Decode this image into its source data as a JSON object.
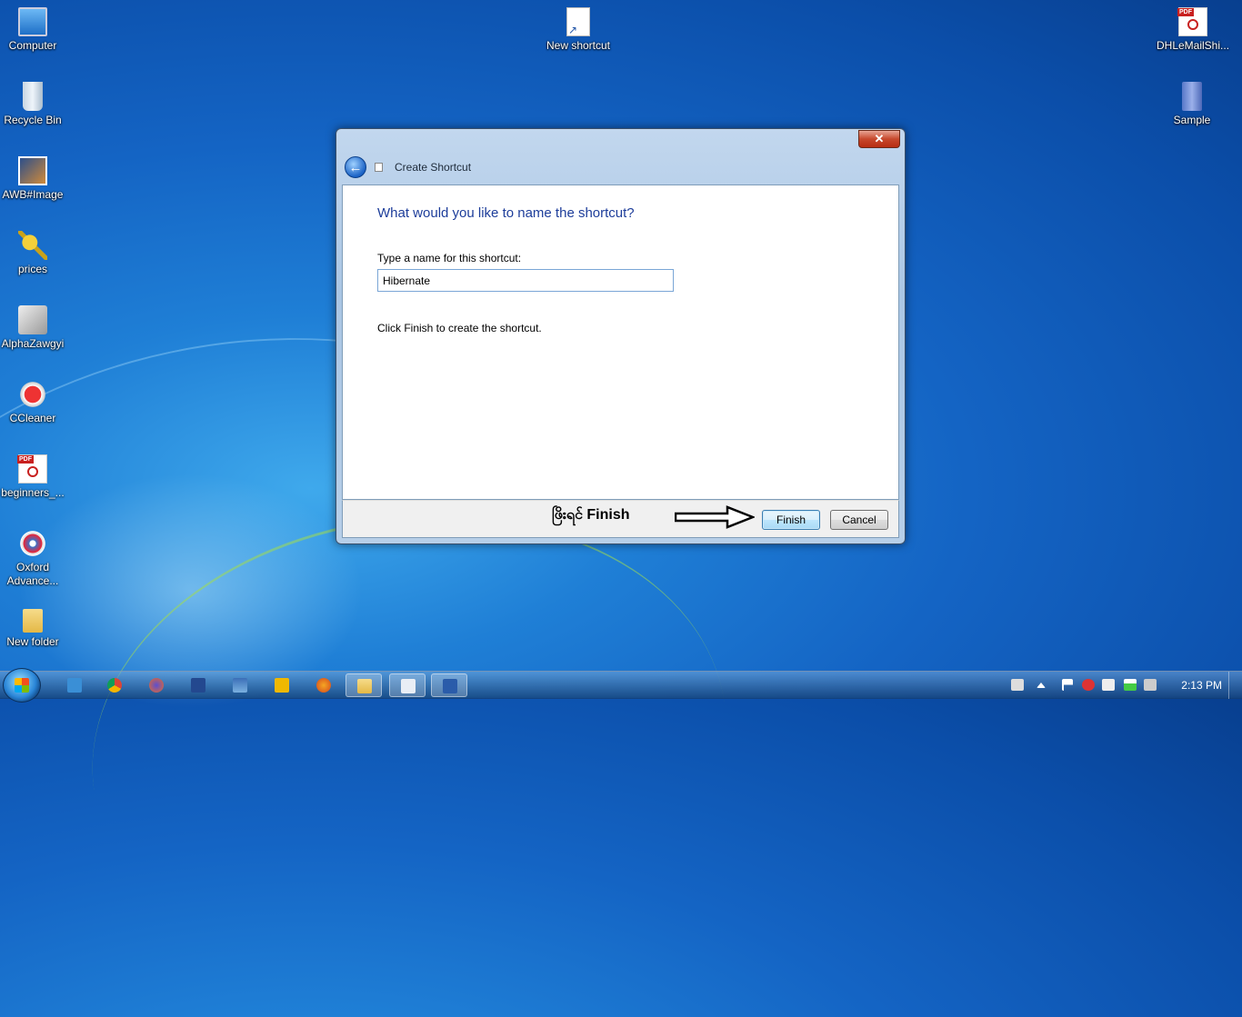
{
  "desktop": {
    "icons_left": [
      {
        "label": "Computer",
        "icon": "computer-icon"
      },
      {
        "label": "Recycle Bin",
        "icon": "recycle-bin-icon"
      },
      {
        "label": "AWB#Image",
        "icon": "image-icon"
      },
      {
        "label": "prices",
        "icon": "key-icon"
      },
      {
        "label": "AlphaZawgyi",
        "icon": "app-icon"
      },
      {
        "label": "CCleaner",
        "icon": "ccleaner-icon"
      },
      {
        "label": "beginners_...",
        "icon": "pdf-icon"
      },
      {
        "label": "Oxford Advance...",
        "icon": "dictionary-icon"
      },
      {
        "label": "New folder",
        "icon": "folder-icon"
      }
    ],
    "new_shortcut": {
      "label": "New shortcut"
    },
    "right_icons": [
      {
        "label": "DHLeMailShi...",
        "icon": "pdf-icon"
      },
      {
        "label": "Sample",
        "icon": "folder-icon"
      }
    ]
  },
  "dialog": {
    "title": "Create Shortcut",
    "close_label": "✕",
    "back_label": "←",
    "heading": "What would you like to name the shortcut?",
    "name_label": "Type a name for this shortcut:",
    "name_value": "Hibernate",
    "hint": "Click Finish to create the shortcut.",
    "annotation": "ဖြိးရင် Finish",
    "finish_label": "Finish",
    "cancel_label": "Cancel"
  },
  "taskbar": {
    "clock": "2:13 PM",
    "items": [
      "mb-app-icon",
      "chrome-icon",
      "firefox-icon",
      "word-icon",
      "image-viewer-icon",
      "outlook-icon",
      "firefox-orange-icon",
      "explorer-icon",
      "notepad-icon",
      "word-document-icon"
    ]
  },
  "colors": {
    "accent": "#1d3d9a",
    "desktop_blue": "#1464c4"
  }
}
